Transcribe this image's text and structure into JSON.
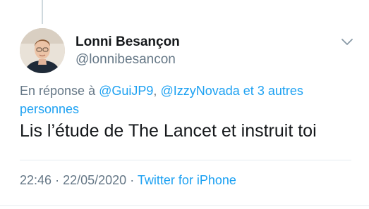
{
  "author": {
    "display_name": "Lonni Besançon",
    "handle": "@lonnibesancon"
  },
  "reply_context": {
    "prefix": "En réponse à",
    "mention_1": "@GuiJP9",
    "separator": ",",
    "mention_2": "@IzzyNovada",
    "connector": "et",
    "others": "3 autres personnes"
  },
  "tweet": {
    "text": "Lis l’étude de The Lancet et instruit toi"
  },
  "meta": {
    "time": "22:46",
    "dot_1": "·",
    "date": "22/05/2020",
    "dot_2": "·",
    "source": "Twitter for iPhone"
  },
  "icons": {
    "menu": "chevron-down-icon",
    "avatar": "profile-photo"
  },
  "colors": {
    "link": "#1da1f2",
    "secondary_text": "#657786",
    "primary_text": "#14171a"
  }
}
